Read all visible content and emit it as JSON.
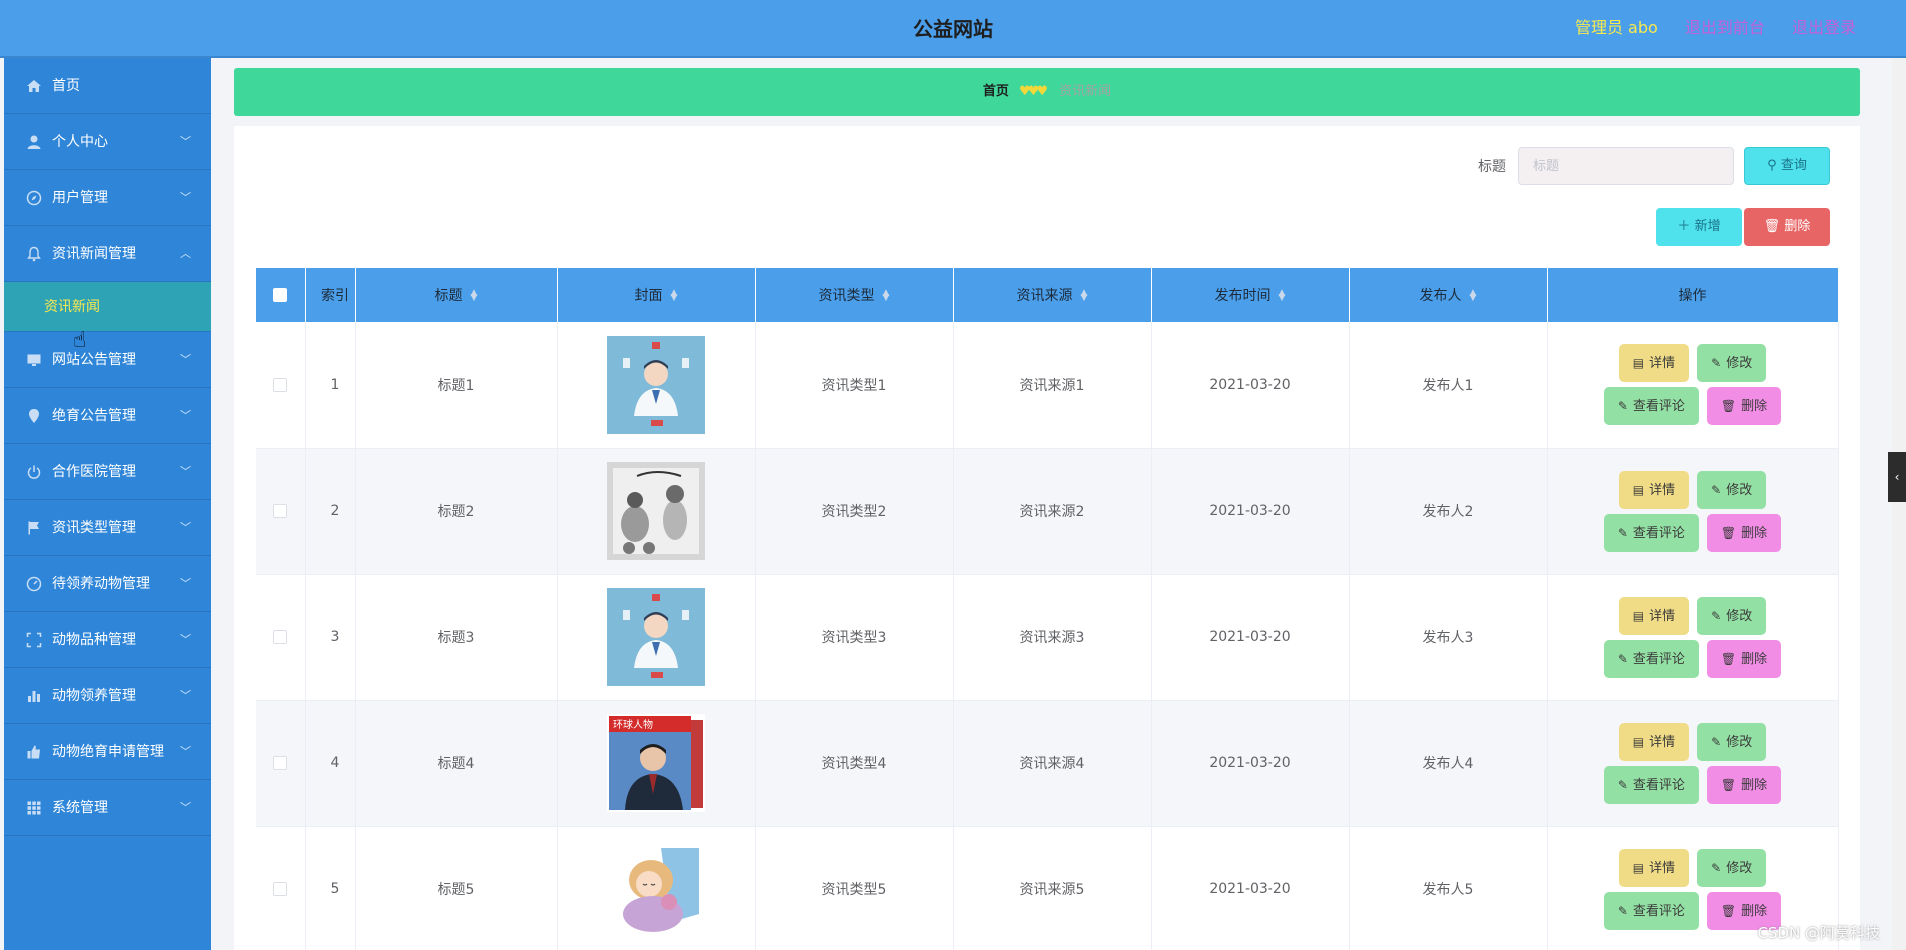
{
  "header": {
    "title": "公益网站",
    "admin_label": "管理员 abo",
    "front_link": "退出到前台",
    "logout_link": "退出登录"
  },
  "sidebar": {
    "items": [
      {
        "label": "首页",
        "icon": "home-icon"
      },
      {
        "label": "个人中心",
        "icon": "user-icon"
      },
      {
        "label": "用户管理",
        "icon": "compass-icon"
      },
      {
        "label": "资讯新闻管理",
        "icon": "bell-icon",
        "expanded": true
      },
      {
        "label": "网站公告管理",
        "icon": "monitor-icon"
      },
      {
        "label": "绝育公告管理",
        "icon": "location-icon"
      },
      {
        "label": "合作医院管理",
        "icon": "power-icon"
      },
      {
        "label": "资讯类型管理",
        "icon": "flag-icon"
      },
      {
        "label": "待领养动物管理",
        "icon": "gauge-icon"
      },
      {
        "label": "动物品种管理",
        "icon": "frame-icon"
      },
      {
        "label": "动物领养管理",
        "icon": "bar-chart-icon"
      },
      {
        "label": "动物绝育申请管理",
        "icon": "thumbs-up-icon"
      },
      {
        "label": "系统管理",
        "icon": "grid-icon"
      }
    ],
    "subitem": "资讯新闻"
  },
  "breadcrumb": {
    "home": "首页",
    "separator": "♥♥♥",
    "current": "资讯新闻"
  },
  "search": {
    "label": "标题",
    "placeholder": "标题",
    "query_button": "查询"
  },
  "toolbar": {
    "add_button": "新增",
    "delete_button": "删除"
  },
  "table": {
    "columns": [
      "索引",
      "标题",
      "封面",
      "资讯类型",
      "资讯来源",
      "发布时间",
      "发布人",
      "操作"
    ],
    "rows": [
      {
        "index": "1",
        "title": "标题1",
        "cover": "doctor-illustration",
        "type": "资讯类型1",
        "source": "资讯来源1",
        "time": "2021-03-20",
        "publisher": "发布人1"
      },
      {
        "index": "2",
        "title": "标题2",
        "cover": "sketch-cartoon",
        "type": "资讯类型2",
        "source": "资讯来源2",
        "time": "2021-03-20",
        "publisher": "发布人2"
      },
      {
        "index": "3",
        "title": "标题3",
        "cover": "doctor-illustration",
        "type": "资讯类型3",
        "source": "资讯来源3",
        "time": "2021-03-20",
        "publisher": "发布人3"
      },
      {
        "index": "4",
        "title": "标题4",
        "cover": "magazine-cover",
        "type": "资讯类型4",
        "source": "资讯来源4",
        "time": "2021-03-20",
        "publisher": "发布人4"
      },
      {
        "index": "5",
        "title": "标题5",
        "cover": "sleeping-child",
        "type": "资讯类型5",
        "source": "资讯来源5",
        "time": "2021-03-20",
        "publisher": "发布人5"
      }
    ],
    "actions": {
      "detail": "详情",
      "edit": "修改",
      "comments": "查看评论",
      "delete": "删除"
    }
  },
  "magazine_cover_text": "环球人物",
  "watermark": "CSDN @阿莫科技",
  "colors": {
    "header": "#4a9eea",
    "sidebar": "#2f86d8",
    "breadcrumb": "#3fd89a",
    "submenu_active": "#2fa3b6",
    "table_header": "#4a9eea",
    "detail_button": "#f0dc86",
    "edit_button": "#93e0a4",
    "delete_button": "#f28de6",
    "query_button": "#4fe1ec"
  }
}
